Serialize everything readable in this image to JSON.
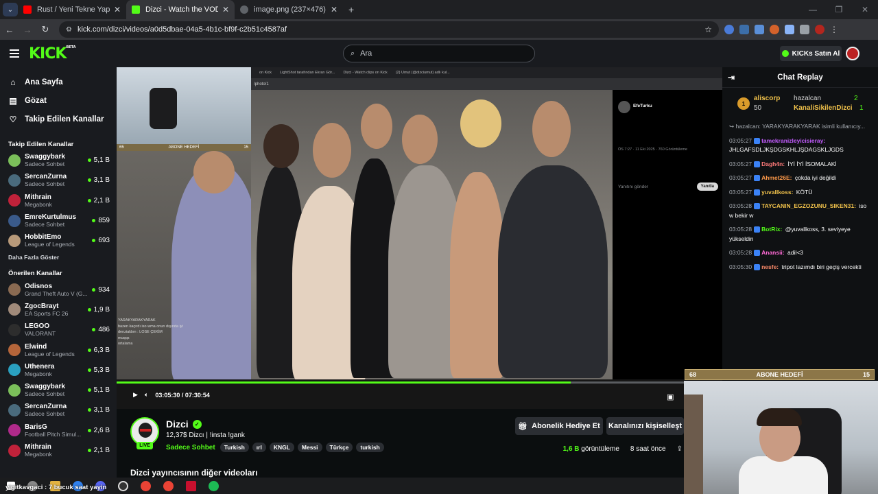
{
  "tabs": [
    {
      "title": "Rust / Yeni Tekne Yapımı / Deniz"
    },
    {
      "title": "Dizci - Watch the VOD on Kick"
    },
    {
      "title": "image.png (237×476)"
    }
  ],
  "browser": {
    "url": "kick.com/dizci/videos/a0d5dbae-04a5-4b1c-bf9f-c2b51c4587af"
  },
  "kick": {
    "logo": "KICK",
    "beta": "BETA",
    "search_placeholder": "Ara",
    "kicks_button": "KICKs Satın Al"
  },
  "sidebar": {
    "nav": [
      "Ana Sayfa",
      "Gözat",
      "Takip Edilen Kanallar"
    ],
    "following_title": "Takip Edilen Kanallar",
    "show_more": "Daha Fazla Göster",
    "recommended_title": "Önerilen Kanallar",
    "following": [
      {
        "name": "Swaggybark",
        "category": "Sadece Sohbet",
        "viewers": "5,1 B",
        "color": "#7bbf5a"
      },
      {
        "name": "SercanZurna",
        "category": "Sadece Sohbet",
        "viewers": "3,1 B",
        "color": "#4a6b7d"
      },
      {
        "name": "Mithrain",
        "category": "Megabonk",
        "viewers": "2,1 B",
        "color": "#c0223a"
      },
      {
        "name": "EmreKurtulmus",
        "category": "Sadece Sohbet",
        "viewers": "859",
        "color": "#3a5a8a"
      },
      {
        "name": "HobbitEmo",
        "category": "League of Legends",
        "viewers": "693",
        "color": "#b89a7a"
      }
    ],
    "recommended": [
      {
        "name": "Odisnos",
        "category": "Grand Theft Auto V (G...",
        "viewers": "934",
        "color": "#8a6a52"
      },
      {
        "name": "ZgocBrayt",
        "category": "EA Sports FC 26",
        "viewers": "1,9 B",
        "color": "#a08a7a"
      },
      {
        "name": "LEGOO",
        "category": "VALORANT",
        "viewers": "486",
        "color": "#2d2d2d"
      },
      {
        "name": "Elwind",
        "category": "League of Legends",
        "viewers": "6,3 B",
        "color": "#b5653a"
      },
      {
        "name": "Uthenera",
        "category": "Megabonk",
        "viewers": "5,3 B",
        "color": "#2aa0c0"
      },
      {
        "name": "Swaggybark",
        "category": "Sadece Sohbet",
        "viewers": "5,1 B",
        "color": "#7bbf5a"
      },
      {
        "name": "SercanZurna",
        "category": "Sadece Sohbet",
        "viewers": "3,1 B",
        "color": "#4a6b7d"
      },
      {
        "name": "BarisG",
        "category": "Football Pitch Simul...",
        "viewers": "2,6 B",
        "color": "#b02a8a"
      },
      {
        "name": "Mithrain",
        "category": "Megabonk",
        "viewers": "2,1 B",
        "color": "#c0223a"
      }
    ]
  },
  "video": {
    "inner_tabs": [
      "on Kick",
      "LightShot tarafından Ekran Gör...",
      "Dizci - Watch clips on Kick",
      "(2) Umut (@dizciumut) adlı kul..."
    ],
    "inner_url": "/photo/1",
    "tweet": {
      "name": "EfeTurku",
      "meta": "ÖS 7:27 · 11 Eki 2025 · 760 Görüntüleme",
      "reply_placeholder": "Yanıtını gönder",
      "reply_button": "Yanıtla"
    },
    "sub_goal_small": {
      "current": "65",
      "label": "ABONE HEDEFİ",
      "target": "15"
    },
    "sub_goal_big": {
      "current": "68",
      "label": "ABONE HEDEFİ",
      "target": "15"
    },
    "overlay_chat": [
      "YARAKYARAKYARAK",
      "bazen kaçırdı iso wma onun dışında iyi",
      "denzialdım : LOSE ÇEKİM",
      "muqqs",
      "ortalama"
    ],
    "progress": 0.75,
    "time_current": "03:05:30",
    "time_total": "07:30:54",
    "ticker": "yigitkavgaci : 7 bucuk saat yayin"
  },
  "channel": {
    "live_label": "LIVE",
    "name": "Dizci",
    "title": "12,37$ Dizcı | !insta !gank",
    "category": "Sadece Sohbet",
    "tags": [
      "Turkish",
      "ırl",
      "KNGL",
      "Messi",
      "Türkçe",
      "turkish"
    ],
    "gift_button": "Abonelik Hediye Et",
    "customize_button": "Kanalınızı kişiselleşt",
    "views_value": "1,6 B",
    "views_label": "görüntüleme",
    "age": "8 saat önce",
    "other_videos_title": "Dizci yayıncısının diğer videoları"
  },
  "chat": {
    "title": "Chat Replay",
    "leader": [
      {
        "name": "aliscorp",
        "count": "50"
      },
      {
        "name": "hazalcan",
        "count": "2"
      },
      {
        "name": "KanaliSikilenDizci",
        "count": "1"
      }
    ],
    "messages": [
      {
        "time": "",
        "user": "",
        "text": "↪ hazalcan: YARAKYARAKYARAK isimli kullanıcıy...",
        "color": "#a7acb3"
      },
      {
        "time": "03:05:27",
        "user": "tamekranizleyicisieray:",
        "text": " JHLGAFSDLJKŞDGSKHLJŞDAGSKLJGDS",
        "color": "#c35cff"
      },
      {
        "time": "03:05:27",
        "user": "Dagh4n:",
        "text": " İYİ İYİ İSOMALAKİ",
        "color": "#ff7a7a"
      },
      {
        "time": "03:05:27",
        "user": "Ahmet26E:",
        "text": " çokda iyi değildi",
        "color": "#ff9a4a"
      },
      {
        "time": "03:05:27",
        "user": "yuvallkoss:",
        "text": " KÖTÜ",
        "color": "#f1c24b"
      },
      {
        "time": "03:05:28",
        "user": "TAYCANIN_EGZOZUNU_SIKEN31:",
        "text": " iso w bekir w",
        "color": "#f1c24b"
      },
      {
        "time": "03:05:28",
        "user": "BotRix:",
        "text": " @yuvallkoss, 3. seviyeye yükseldin",
        "color": "#53fc18"
      },
      {
        "time": "03:05:28",
        "user": "Anansii:",
        "text": " adil<3",
        "color": "#ff6ad5"
      },
      {
        "time": "03:05:30",
        "user": "nesfe:",
        "text": " tripot lazımdı biri geçiş vercekti",
        "color": "#ff8c6a"
      }
    ]
  },
  "colors": {
    "accent": "#53fc18",
    "background": "#0b0e0f",
    "panel": "#191b1f"
  }
}
